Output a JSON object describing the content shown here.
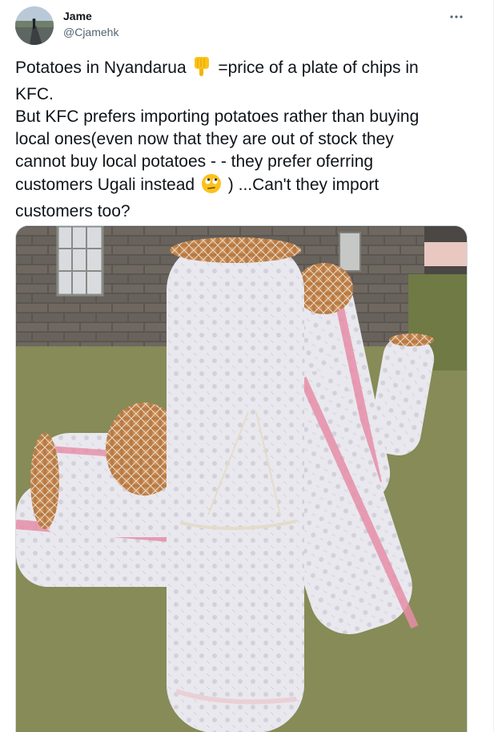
{
  "author": {
    "display_name": "Jame",
    "handle": "@Cjamehk",
    "avatar_icon": "profile-photo-road"
  },
  "menu": {
    "more_icon": "more-dots-icon"
  },
  "tweet": {
    "line1_a": "Potatoes in Nyandarua",
    "line1_b": "=price of a plate of chips in",
    "line2": "KFC.",
    "line3": "But KFC prefers importing potatoes rather than buying",
    "line4": "local ones(even now that they are out of stock they",
    "line5": "cannot buy local potatoes - - they prefer oferring",
    "line6_a": "customers Ugali instead",
    "line6_b": ") ...Can't they import",
    "line7": "customers too?",
    "emoji_1": "pointing-down-hand-emoji",
    "emoji_2": "rolling-eyes-face-emoji"
  },
  "media": {
    "image_icon": "photo-potato-sacks"
  },
  "colors": {
    "text": "#0f1419",
    "secondary": "#536471",
    "border": "#cfd9de"
  }
}
